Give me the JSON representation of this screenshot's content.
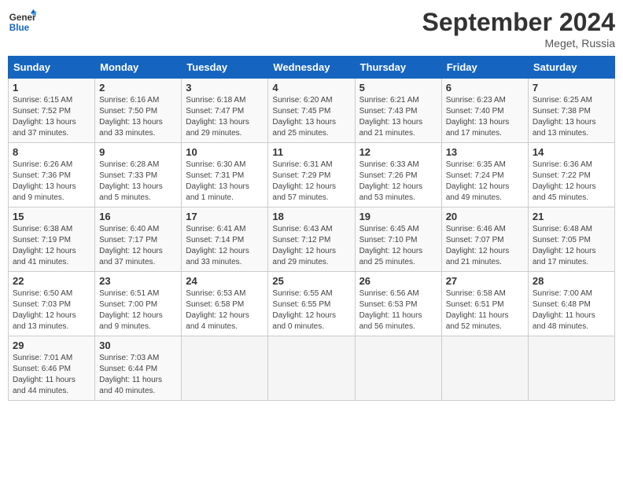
{
  "logo": {
    "line1": "General",
    "line2": "Blue"
  },
  "title": "September 2024",
  "subtitle": "Meget, Russia",
  "days_of_week": [
    "Sunday",
    "Monday",
    "Tuesday",
    "Wednesday",
    "Thursday",
    "Friday",
    "Saturday"
  ],
  "weeks": [
    [
      {
        "day": "1",
        "info": "Sunrise: 6:15 AM\nSunset: 7:52 PM\nDaylight: 13 hours\nand 37 minutes."
      },
      {
        "day": "2",
        "info": "Sunrise: 6:16 AM\nSunset: 7:50 PM\nDaylight: 13 hours\nand 33 minutes."
      },
      {
        "day": "3",
        "info": "Sunrise: 6:18 AM\nSunset: 7:47 PM\nDaylight: 13 hours\nand 29 minutes."
      },
      {
        "day": "4",
        "info": "Sunrise: 6:20 AM\nSunset: 7:45 PM\nDaylight: 13 hours\nand 25 minutes."
      },
      {
        "day": "5",
        "info": "Sunrise: 6:21 AM\nSunset: 7:43 PM\nDaylight: 13 hours\nand 21 minutes."
      },
      {
        "day": "6",
        "info": "Sunrise: 6:23 AM\nSunset: 7:40 PM\nDaylight: 13 hours\nand 17 minutes."
      },
      {
        "day": "7",
        "info": "Sunrise: 6:25 AM\nSunset: 7:38 PM\nDaylight: 13 hours\nand 13 minutes."
      }
    ],
    [
      {
        "day": "8",
        "info": "Sunrise: 6:26 AM\nSunset: 7:36 PM\nDaylight: 13 hours\nand 9 minutes."
      },
      {
        "day": "9",
        "info": "Sunrise: 6:28 AM\nSunset: 7:33 PM\nDaylight: 13 hours\nand 5 minutes."
      },
      {
        "day": "10",
        "info": "Sunrise: 6:30 AM\nSunset: 7:31 PM\nDaylight: 13 hours\nand 1 minute."
      },
      {
        "day": "11",
        "info": "Sunrise: 6:31 AM\nSunset: 7:29 PM\nDaylight: 12 hours\nand 57 minutes."
      },
      {
        "day": "12",
        "info": "Sunrise: 6:33 AM\nSunset: 7:26 PM\nDaylight: 12 hours\nand 53 minutes."
      },
      {
        "day": "13",
        "info": "Sunrise: 6:35 AM\nSunset: 7:24 PM\nDaylight: 12 hours\nand 49 minutes."
      },
      {
        "day": "14",
        "info": "Sunrise: 6:36 AM\nSunset: 7:22 PM\nDaylight: 12 hours\nand 45 minutes."
      }
    ],
    [
      {
        "day": "15",
        "info": "Sunrise: 6:38 AM\nSunset: 7:19 PM\nDaylight: 12 hours\nand 41 minutes."
      },
      {
        "day": "16",
        "info": "Sunrise: 6:40 AM\nSunset: 7:17 PM\nDaylight: 12 hours\nand 37 minutes."
      },
      {
        "day": "17",
        "info": "Sunrise: 6:41 AM\nSunset: 7:14 PM\nDaylight: 12 hours\nand 33 minutes."
      },
      {
        "day": "18",
        "info": "Sunrise: 6:43 AM\nSunset: 7:12 PM\nDaylight: 12 hours\nand 29 minutes."
      },
      {
        "day": "19",
        "info": "Sunrise: 6:45 AM\nSunset: 7:10 PM\nDaylight: 12 hours\nand 25 minutes."
      },
      {
        "day": "20",
        "info": "Sunrise: 6:46 AM\nSunset: 7:07 PM\nDaylight: 12 hours\nand 21 minutes."
      },
      {
        "day": "21",
        "info": "Sunrise: 6:48 AM\nSunset: 7:05 PM\nDaylight: 12 hours\nand 17 minutes."
      }
    ],
    [
      {
        "day": "22",
        "info": "Sunrise: 6:50 AM\nSunset: 7:03 PM\nDaylight: 12 hours\nand 13 minutes."
      },
      {
        "day": "23",
        "info": "Sunrise: 6:51 AM\nSunset: 7:00 PM\nDaylight: 12 hours\nand 9 minutes."
      },
      {
        "day": "24",
        "info": "Sunrise: 6:53 AM\nSunset: 6:58 PM\nDaylight: 12 hours\nand 4 minutes."
      },
      {
        "day": "25",
        "info": "Sunrise: 6:55 AM\nSunset: 6:55 PM\nDaylight: 12 hours\nand 0 minutes."
      },
      {
        "day": "26",
        "info": "Sunrise: 6:56 AM\nSunset: 6:53 PM\nDaylight: 11 hours\nand 56 minutes."
      },
      {
        "day": "27",
        "info": "Sunrise: 6:58 AM\nSunset: 6:51 PM\nDaylight: 11 hours\nand 52 minutes."
      },
      {
        "day": "28",
        "info": "Sunrise: 7:00 AM\nSunset: 6:48 PM\nDaylight: 11 hours\nand 48 minutes."
      }
    ],
    [
      {
        "day": "29",
        "info": "Sunrise: 7:01 AM\nSunset: 6:46 PM\nDaylight: 11 hours\nand 44 minutes."
      },
      {
        "day": "30",
        "info": "Sunrise: 7:03 AM\nSunset: 6:44 PM\nDaylight: 11 hours\nand 40 minutes."
      },
      {
        "day": "",
        "info": ""
      },
      {
        "day": "",
        "info": ""
      },
      {
        "day": "",
        "info": ""
      },
      {
        "day": "",
        "info": ""
      },
      {
        "day": "",
        "info": ""
      }
    ]
  ]
}
